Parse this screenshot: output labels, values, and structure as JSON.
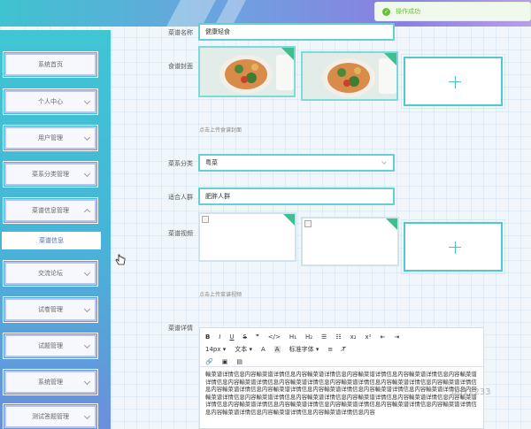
{
  "toast": {
    "message": "操作成功"
  },
  "sidebar": {
    "items": [
      {
        "label": "系统首页",
        "chevron": "none"
      },
      {
        "label": "个人中心",
        "chevron": "down"
      },
      {
        "label": "用户管理",
        "chevron": "down"
      },
      {
        "label": "菜系分类管理",
        "chevron": "down"
      },
      {
        "label": "菜谱信息管理",
        "chevron": "up"
      },
      {
        "label": "交流论坛",
        "chevron": "down"
      },
      {
        "label": "试卷管理",
        "chevron": "down"
      },
      {
        "label": "试题管理",
        "chevron": "down"
      },
      {
        "label": "系统管理",
        "chevron": "down"
      },
      {
        "label": "测试答题管理",
        "chevron": "down"
      }
    ],
    "submenu": {
      "label": "菜谱信息"
    }
  },
  "form": {
    "recipe_name": {
      "label": "菜谱名称",
      "value": "健康轻食"
    },
    "cover": {
      "label": "食谱封面",
      "hint": "点击上传食谱封面"
    },
    "cuisine": {
      "label": "菜系分类",
      "value": "粤菜"
    },
    "audience": {
      "label": "适合人群",
      "value": "肥胖人群"
    },
    "video": {
      "label": "菜谱视频",
      "hint": "点击上传菜谱视频"
    },
    "details": {
      "label": "菜谱详情"
    }
  },
  "editor": {
    "toolbar_row1": [
      "B",
      "I",
      "U",
      "S",
      "❞",
      "</>",
      "H₁",
      "H₂",
      "☰",
      "☷",
      "x₂",
      "x²",
      "⇤",
      "⇥"
    ],
    "font_size": "14px",
    "text_label": "文本",
    "font_family": "标准字体",
    "content": "輸菜谱详情信息内容輸菜谱详情信息内容輸菜谱详情信息内容輸菜谱详情信息内容輸菜谱详情信息内容輸菜谱详情信息内容輸菜谱详情信息内容輸菜谱详情信息内容輸菜谱详情信息内容輸菜谱详情信息内容輸菜谱详情信息内容輸菜谱详情信息内容輸菜谱详情信息内容輸菜谱详情信息内容輸菜谱详情信息内容輸菜谱详情信息内容輸菜谱详情信息内容輸菜谱详情信息内容輸菜谱详情信息内容輸菜谱详情信息内容輸菜谱详情信息内容輸菜谱详情信息内容輸菜谱详情信息内容輸菜谱详情信息内容輸菜谱详情信息内容輸菜谱详情信息内容輸菜谱详情信息内容輸菜谱详情信息内容輸菜谱详情信息内容輸菜谱详情信息内容"
  },
  "watermark": "0612233",
  "colors": {
    "accent": "#52c7cf",
    "success": "#67c23a",
    "sidebar_top": "#3fc6d3",
    "sidebar_bottom": "#6a8fdc"
  }
}
